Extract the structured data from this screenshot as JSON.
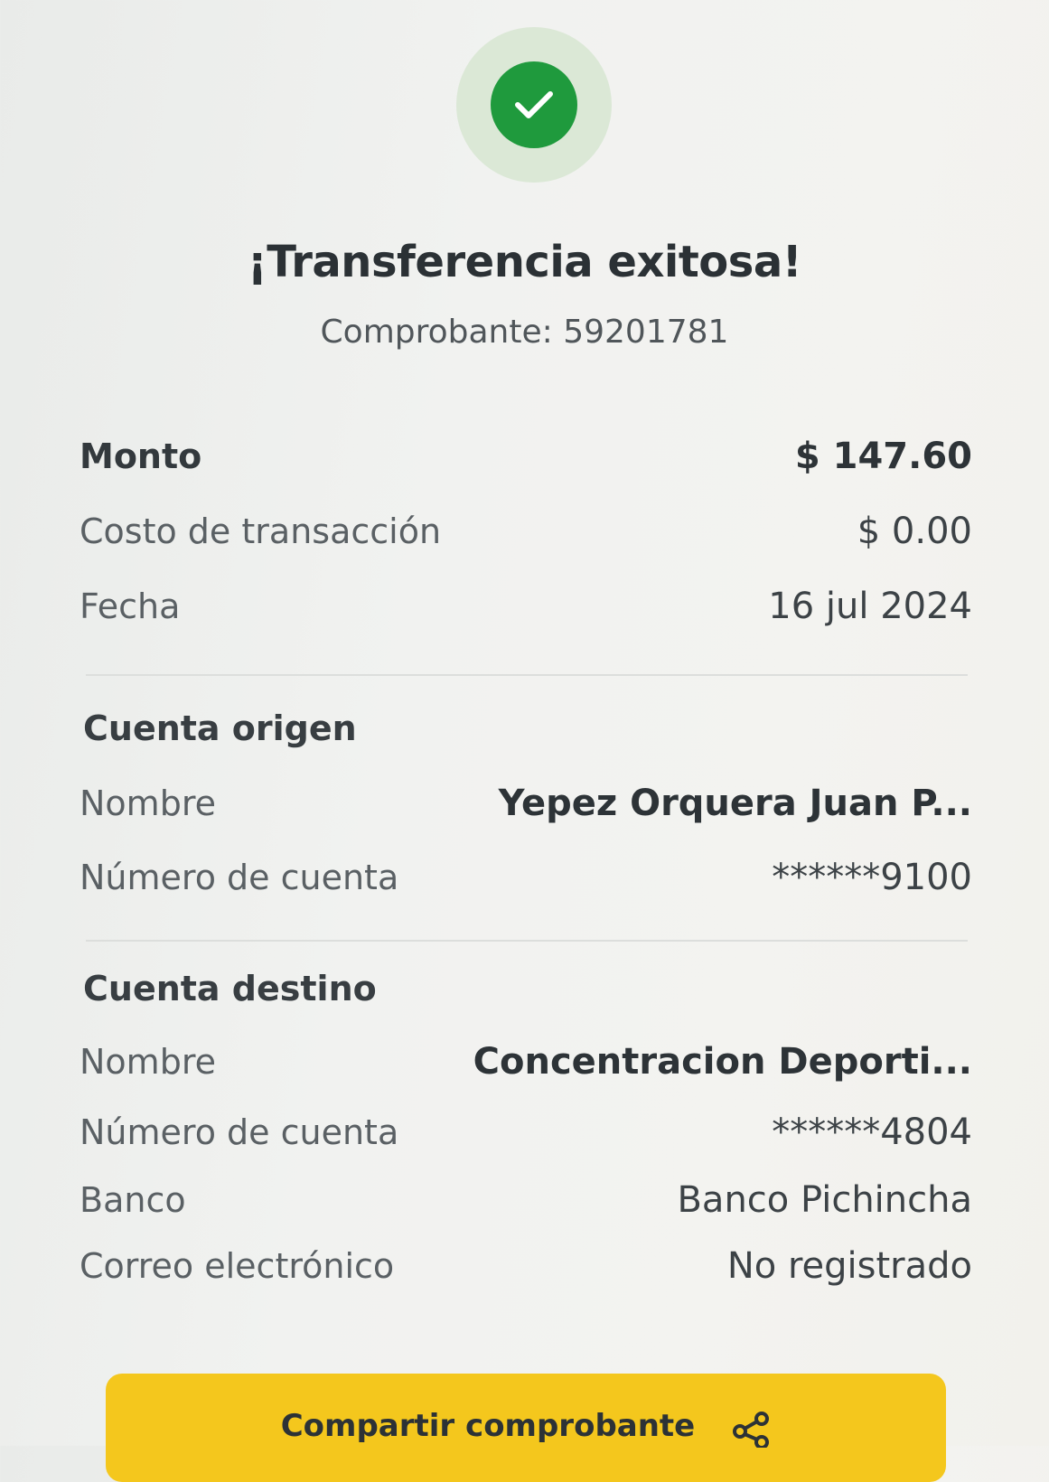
{
  "header": {
    "status_icon": "check-icon",
    "title": "¡Transferencia exitosa!",
    "receipt": "Comprobante: 59201781"
  },
  "summary": {
    "amount_label": "Monto",
    "amount_value": "$ 147.60",
    "fee_label": "Costo de transacción",
    "fee_value": "$ 0.00",
    "date_label": "Fecha",
    "date_value": "16 jul 2024"
  },
  "origin": {
    "title": "Cuenta origen",
    "name_label": "Nombre",
    "name_value": "Yepez  Orquera Juan P...",
    "account_label": "Número de cuenta",
    "account_value": "******9100"
  },
  "destination": {
    "title": "Cuenta destino",
    "name_label": "Nombre",
    "name_value": "Concentracion Deporti...",
    "account_label": "Número de cuenta",
    "account_value": "******4804",
    "bank_label": "Banco",
    "bank_value": "Banco Pichincha",
    "email_label": "Correo electrónico",
    "email_value": "No registrado"
  },
  "actions": {
    "share_label": "Compartir comprobante",
    "share_icon": "share-icon"
  },
  "colors": {
    "success": "#1f9a3d",
    "success_ring": "#dbe8d6",
    "button": "#f4c71d"
  }
}
